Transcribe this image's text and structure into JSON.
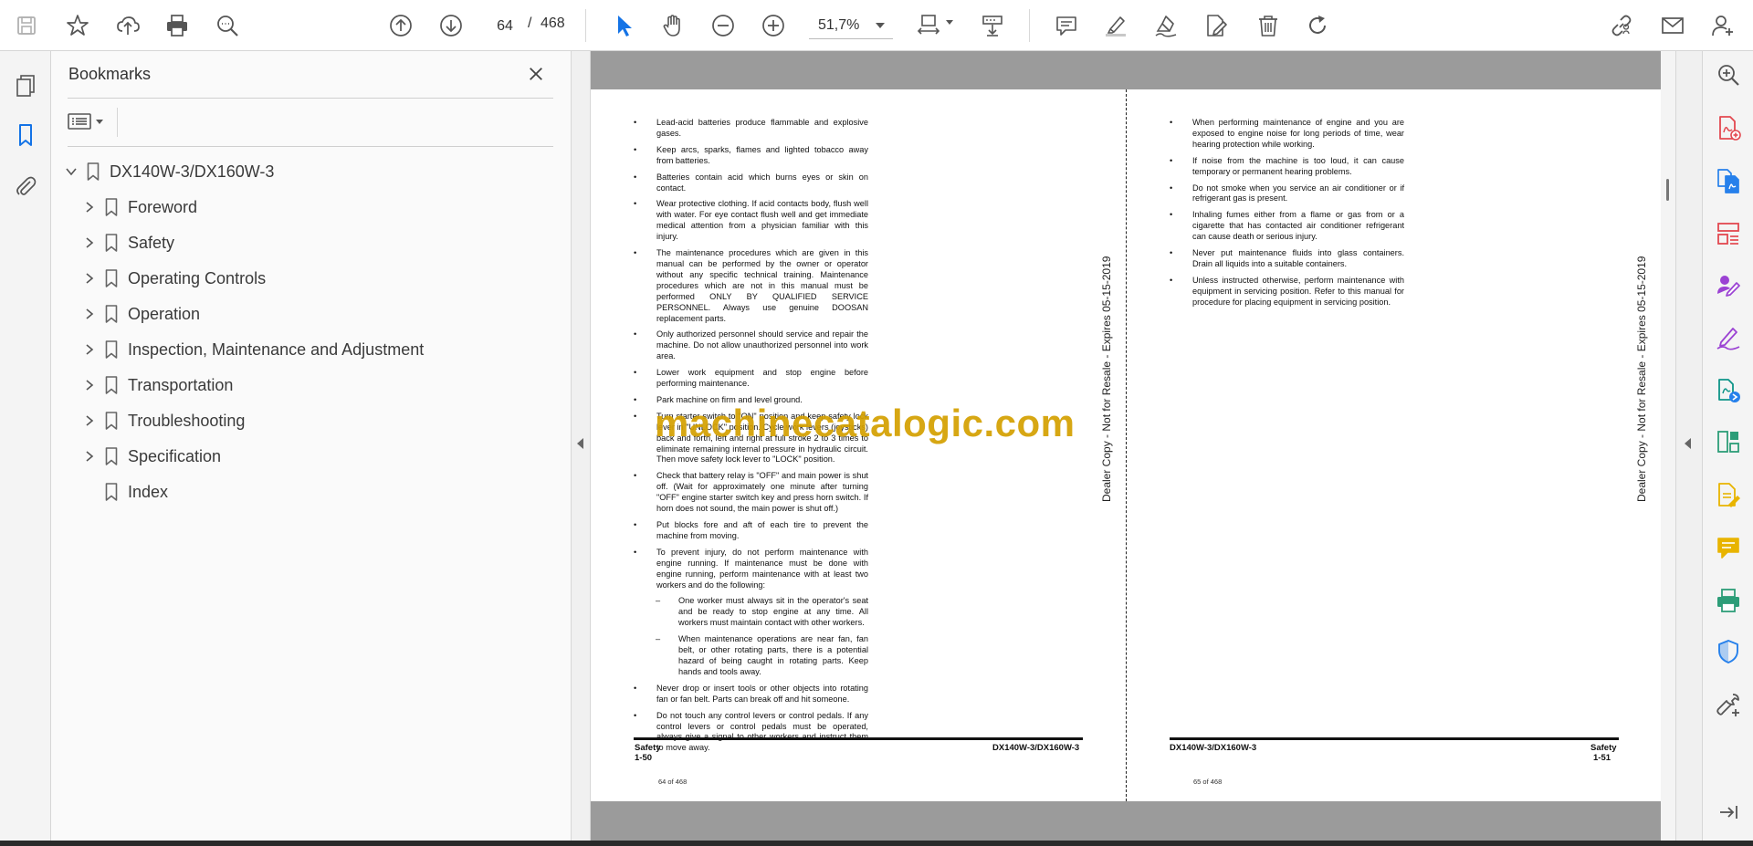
{
  "toolbar": {
    "page_current": "64",
    "page_separator": "/",
    "page_total": "468",
    "zoom": "51,7%"
  },
  "bookmarks": {
    "title": "Bookmarks",
    "items": [
      {
        "label": "DX140W-3/DX160W-3",
        "expanded": true
      },
      {
        "label": "Foreword"
      },
      {
        "label": "Safety"
      },
      {
        "label": "Operating Controls"
      },
      {
        "label": "Operation"
      },
      {
        "label": "Inspection, Maintenance and Adjustment"
      },
      {
        "label": "Transportation"
      },
      {
        "label": "Troubleshooting"
      },
      {
        "label": "Specification"
      },
      {
        "label": "Index"
      }
    ]
  },
  "document": {
    "left_page": {
      "items": [
        {
          "type": "bullet",
          "text": "Lead-acid batteries produce flammable and explosive gases."
        },
        {
          "type": "bullet",
          "text": "Keep arcs, sparks, flames and lighted tobacco away from batteries."
        },
        {
          "type": "bullet",
          "text": "Batteries contain acid which burns eyes or skin on contact."
        },
        {
          "type": "bullet",
          "text": "Wear protective clothing. If acid contacts body, flush well with water. For eye contact flush well and get immediate medical attention from a physician familiar with this injury."
        },
        {
          "type": "bullet",
          "text": "The maintenance procedures which are given in this manual can be performed by the owner or operator without any specific technical training. Maintenance procedures which are not in this manual must be performed ONLY BY QUALIFIED SERVICE PERSONNEL. Always use genuine DOOSAN replacement parts."
        },
        {
          "type": "bullet",
          "text": "Only authorized personnel should service and repair the machine. Do not allow unauthorized personnel into work area."
        },
        {
          "type": "bullet",
          "text": "Lower work equipment and stop engine before performing maintenance."
        },
        {
          "type": "bullet",
          "text": "Park machine on firm and level ground."
        },
        {
          "type": "bullet",
          "text": "Turn starter switch to \"ON\" position and keep safety lock lever in \"UNLOCK\" position. Cycle work levers (joysticks) back and forth, left and right at full stroke 2 to 3 times to eliminate remaining internal pressure in hydraulic circuit. Then move safety lock lever to \"LOCK\" position."
        },
        {
          "type": "bullet",
          "text": "Check that battery relay is \"OFF\" and main power is shut off. (Wait for approximately one minute after turning \"OFF\" engine starter switch key and press horn switch. If horn does not sound, the main power is shut off.)"
        },
        {
          "type": "bullet",
          "text": "Put blocks fore and aft of each tire to prevent the machine from moving."
        },
        {
          "type": "bullet",
          "text": "To prevent injury, do not perform maintenance with engine running. If maintenance must be done with engine running, perform maintenance with at least two workers and do the following:"
        },
        {
          "type": "dash",
          "text": "One worker must always sit in the operator's seat and be ready to stop engine at any time. All workers must maintain contact with other workers."
        },
        {
          "type": "dash",
          "text": "When maintenance operations are near fan, fan belt, or other rotating parts, there is a potential hazard of being caught in rotating parts. Keep hands and tools away."
        },
        {
          "type": "bullet",
          "text": "Never drop or insert tools or other objects into rotating fan or fan belt. Parts can break off and hit someone."
        },
        {
          "type": "bullet",
          "text": "Do not touch any control levers or control pedals. If any control levers or control pedals must be operated, always give a signal to other workers and instruct them to move away."
        }
      ],
      "footer_section": "Safety",
      "footer_page": "1-50",
      "footer_model": "DX140W-3/DX160W-3",
      "page_of": "64 of 468",
      "side_note": "Dealer Copy - Not for Resale - Expires 05-15-2019"
    },
    "right_page": {
      "items": [
        {
          "type": "bullet",
          "text": "When performing maintenance of engine and you are exposed to engine noise for long periods of time, wear hearing protection while working."
        },
        {
          "type": "bullet",
          "text": "If noise from the machine is too loud, it can cause temporary or permanent hearing problems."
        },
        {
          "type": "bullet",
          "text": "Do not smoke when you service an air conditioner or if refrigerant gas is present."
        },
        {
          "type": "bullet",
          "text": "Inhaling fumes either from a flame or gas from or a cigarette that has contacted air conditioner refrigerant can cause death or serious injury."
        },
        {
          "type": "bullet",
          "text": "Never put maintenance fluids into glass containers. Drain all liquids into a suitable containers."
        },
        {
          "type": "bullet",
          "text": "Unless instructed otherwise, perform maintenance with equipment in servicing position. Refer to this manual for procedure for placing equipment in servicing position."
        }
      ],
      "footer_model": "DX140W-3/DX160W-3",
      "footer_section": "Safety",
      "footer_page": "1-51",
      "page_of": "65 of 468",
      "side_note": "Dealer Copy - Not for Resale - Expires 05-15-2019"
    },
    "watermark": "machinecatalogic.com"
  },
  "icons": {
    "toolbar": [
      "save-icon",
      "bookmark-star-icon",
      "upload-cloud-icon",
      "print-icon",
      "search-zoom-icon",
      "page-up-icon",
      "page-down-icon",
      "select-arrow-icon",
      "hand-icon",
      "zoom-out-icon",
      "zoom-in-icon",
      "page-fit-icon",
      "scroll-mode-icon",
      "comment-icon",
      "highlight-icon",
      "sign-icon",
      "edit-pdf-icon",
      "delete-icon",
      "rotate-icon",
      "share-link-icon",
      "mail-icon",
      "account-icon"
    ],
    "right_tools": [
      "zoom-tools-icon",
      "export-pdf-icon",
      "create-pdf-icon",
      "organize-pages-icon",
      "fill-sign-icon",
      "signature-icon",
      "send-for-review-icon",
      "compare-icon",
      "edit-document-icon",
      "comment-tool-icon",
      "print-production-icon",
      "protect-icon",
      "more-tools-icon",
      "collapse-tools-icon"
    ]
  },
  "colors": {
    "accent_blue": "#1473e6",
    "watermark": "#d4a000",
    "red_tool": "#e34850",
    "purple_tool": "#9b42d3",
    "teal_tool": "#0d9488",
    "yellow_tool": "#e8b400",
    "green_tool": "#2d9d78"
  }
}
